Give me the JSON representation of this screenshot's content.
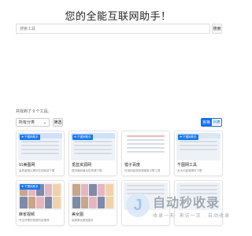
{
  "hero": {
    "title": "您的全能互联网助手！"
  },
  "search": {
    "placeholder": "搜索工具",
    "button_label": "搜索"
  },
  "results": {
    "count_text": "共找到了 9 个工具。"
  },
  "filter": {
    "selected": "所有分类",
    "caret": "⌄",
    "apply_label": "筛选"
  },
  "view_toggle": {
    "grid_label": "宫格",
    "list_label": "列表"
  },
  "cards": [
    {
      "badge": "❖ 千图网助手",
      "title": "91美图网",
      "desc": "高质量图片素材在线免费下载"
    },
    {
      "badge": "❖ 千图网助手",
      "title": "觅蓝资源网",
      "desc": "提供最新最全的资源下载"
    },
    {
      "badge": "",
      "title": "猎子百度",
      "desc": "好用的影视资源搜索引擎工具"
    },
    {
      "badge": "❖ 千图网助手",
      "title": "千图网工具",
      "desc": "无水印高清素材下载"
    },
    {
      "badge": "❖ 千图网助手",
      "title": "麻雀视频",
      "desc": "专注好看的视频内容推荐"
    },
    {
      "badge": "",
      "title": "美女图",
      "desc": "高清美女壁纸图片"
    },
    {
      "badge": "",
      "title": "",
      "desc": ""
    },
    {
      "badge": "",
      "title": "",
      "desc": ""
    }
  ],
  "watermark": {
    "main": "自动秒收录",
    "sub": "收录一天· 来访一次 · 自动收录"
  },
  "colors": {
    "accent": "#0d6efd",
    "badge": "#1677ff"
  }
}
